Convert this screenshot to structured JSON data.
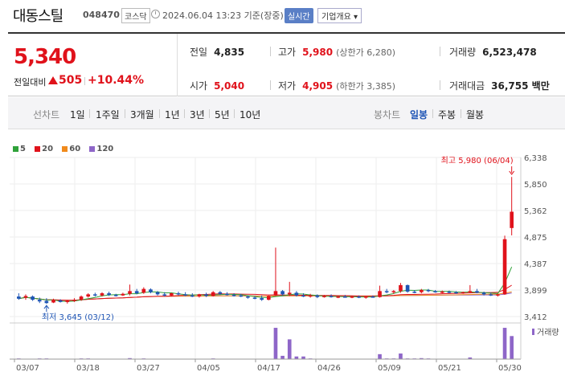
{
  "header": {
    "name": "대동스틸",
    "code": "048470",
    "market": "코스닥",
    "time": "2024.06.04 13:23 기준(장중)",
    "realtime_label": "실시간",
    "overview_label": "기업개요 ▾"
  },
  "quote": {
    "price": "5,340",
    "change_label": "전일대비",
    "change": "505",
    "change_pct": "+10.44%",
    "stats": {
      "prev_close": {
        "label": "전일",
        "value": "4,835"
      },
      "high": {
        "label": "고가",
        "value": "5,980",
        "extra": "(상한가 6,280)"
      },
      "volume": {
        "label": "거래량",
        "value": "6,523,478"
      },
      "open": {
        "label": "시가",
        "value": "5,040"
      },
      "low": {
        "label": "저가",
        "value": "4,905",
        "extra": "(하한가 3,385)"
      },
      "amount": {
        "label": "거래대금",
        "value": "36,755 백만"
      }
    }
  },
  "period_bar": {
    "line_label": "선차트",
    "line_periods": [
      "1일",
      "1주일",
      "3개월",
      "1년",
      "3년",
      "5년",
      "10년"
    ],
    "candle_label": "봉차트",
    "candle_periods": [
      "일봉",
      "주봉",
      "월봉"
    ],
    "selected_candle": "일봉"
  },
  "colors": {
    "up": "#e0121b",
    "down": "#1f55b5",
    "ma5": "#2fa23a",
    "ma20": "#e0121b",
    "ma60": "#f08a1c",
    "ma120": "#8e66c8"
  },
  "chart_data": {
    "type": "candlestick",
    "legend": [
      {
        "name": "5",
        "color": "#2fa23a"
      },
      {
        "name": "20",
        "color": "#e0121b"
      },
      {
        "name": "60",
        "color": "#f08a1c"
      },
      {
        "name": "120",
        "color": "#8e66c8"
      }
    ],
    "y_ticks": [
      "6,338",
      "5,850",
      "5,362",
      "4,875",
      "4,387",
      "3,899",
      "3,412"
    ],
    "ylim": [
      3412,
      6338
    ],
    "x_ticks": [
      "03/07",
      "03/18",
      "03/27",
      "04/05",
      "04/17",
      "04/26",
      "05/09",
      "05/21",
      "05/30"
    ],
    "max_annotation": "최고 5,980 (06/04)",
    "min_annotation": "최저 3,645 (03/12)",
    "volume_label": "거래량",
    "candles": [
      {
        "o": 3780,
        "h": 3840,
        "l": 3720,
        "c": 3740
      },
      {
        "o": 3760,
        "h": 3820,
        "l": 3720,
        "c": 3790
      },
      {
        "o": 3780,
        "h": 3800,
        "l": 3700,
        "c": 3720
      },
      {
        "o": 3720,
        "h": 3760,
        "l": 3660,
        "c": 3690
      },
      {
        "o": 3700,
        "h": 3750,
        "l": 3645,
        "c": 3660
      },
      {
        "o": 3670,
        "h": 3740,
        "l": 3660,
        "c": 3720
      },
      {
        "o": 3710,
        "h": 3730,
        "l": 3670,
        "c": 3680
      },
      {
        "o": 3690,
        "h": 3720,
        "l": 3650,
        "c": 3700
      },
      {
        "o": 3700,
        "h": 3750,
        "l": 3680,
        "c": 3720
      },
      {
        "o": 3720,
        "h": 3800,
        "l": 3700,
        "c": 3780
      },
      {
        "o": 3780,
        "h": 3840,
        "l": 3760,
        "c": 3820
      },
      {
        "o": 3820,
        "h": 3850,
        "l": 3780,
        "c": 3800
      },
      {
        "o": 3800,
        "h": 3860,
        "l": 3780,
        "c": 3840
      },
      {
        "o": 3840,
        "h": 3870,
        "l": 3790,
        "c": 3810
      },
      {
        "o": 3810,
        "h": 3830,
        "l": 3780,
        "c": 3800
      },
      {
        "o": 3800,
        "h": 3850,
        "l": 3790,
        "c": 3830
      },
      {
        "o": 3830,
        "h": 4000,
        "l": 3800,
        "c": 3880
      },
      {
        "o": 3880,
        "h": 3920,
        "l": 3820,
        "c": 3840
      },
      {
        "o": 3850,
        "h": 3950,
        "l": 3830,
        "c": 3920
      },
      {
        "o": 3910,
        "h": 3930,
        "l": 3840,
        "c": 3860
      },
      {
        "o": 3860,
        "h": 3880,
        "l": 3800,
        "c": 3820
      },
      {
        "o": 3820,
        "h": 3860,
        "l": 3780,
        "c": 3800
      },
      {
        "o": 3800,
        "h": 3850,
        "l": 3780,
        "c": 3840
      },
      {
        "o": 3840,
        "h": 3870,
        "l": 3800,
        "c": 3820
      },
      {
        "o": 3820,
        "h": 3860,
        "l": 3790,
        "c": 3800
      },
      {
        "o": 3800,
        "h": 3840,
        "l": 3770,
        "c": 3780
      },
      {
        "o": 3780,
        "h": 3830,
        "l": 3760,
        "c": 3820
      },
      {
        "o": 3820,
        "h": 3850,
        "l": 3770,
        "c": 3790
      },
      {
        "o": 3790,
        "h": 3880,
        "l": 3780,
        "c": 3860
      },
      {
        "o": 3860,
        "h": 3880,
        "l": 3810,
        "c": 3830
      },
      {
        "o": 3830,
        "h": 3860,
        "l": 3800,
        "c": 3810
      },
      {
        "o": 3810,
        "h": 3840,
        "l": 3780,
        "c": 3800
      },
      {
        "o": 3800,
        "h": 3830,
        "l": 3770,
        "c": 3780
      },
      {
        "o": 3780,
        "h": 3800,
        "l": 3740,
        "c": 3760
      },
      {
        "o": 3760,
        "h": 3790,
        "l": 3730,
        "c": 3750
      },
      {
        "o": 3750,
        "h": 3800,
        "l": 3700,
        "c": 3720
      },
      {
        "o": 3720,
        "h": 3800,
        "l": 3710,
        "c": 3790
      },
      {
        "o": 3800,
        "h": 4680,
        "l": 3790,
        "c": 3880
      },
      {
        "o": 3880,
        "h": 3900,
        "l": 3800,
        "c": 3820
      },
      {
        "o": 3820,
        "h": 4050,
        "l": 3790,
        "c": 3850
      },
      {
        "o": 3850,
        "h": 3880,
        "l": 3780,
        "c": 3800
      },
      {
        "o": 3800,
        "h": 3840,
        "l": 3770,
        "c": 3780
      },
      {
        "o": 3790,
        "h": 3830,
        "l": 3760,
        "c": 3800
      },
      {
        "o": 3800,
        "h": 3820,
        "l": 3750,
        "c": 3770
      },
      {
        "o": 3770,
        "h": 3810,
        "l": 3760,
        "c": 3790
      },
      {
        "o": 3790,
        "h": 3820,
        "l": 3760,
        "c": 3770
      },
      {
        "o": 3770,
        "h": 3800,
        "l": 3750,
        "c": 3780
      },
      {
        "o": 3780,
        "h": 3810,
        "l": 3760,
        "c": 3770
      },
      {
        "o": 3770,
        "h": 3790,
        "l": 3750,
        "c": 3780
      },
      {
        "o": 3780,
        "h": 3800,
        "l": 3750,
        "c": 3760
      },
      {
        "o": 3760,
        "h": 3790,
        "l": 3740,
        "c": 3780
      },
      {
        "o": 3780,
        "h": 3800,
        "l": 3760,
        "c": 3770
      },
      {
        "o": 3770,
        "h": 3980,
        "l": 3760,
        "c": 3880
      },
      {
        "o": 3880,
        "h": 3920,
        "l": 3840,
        "c": 3860
      },
      {
        "o": 3860,
        "h": 3900,
        "l": 3830,
        "c": 3880
      },
      {
        "o": 3880,
        "h": 4030,
        "l": 3850,
        "c": 3990
      },
      {
        "o": 3990,
        "h": 4000,
        "l": 3850,
        "c": 3870
      },
      {
        "o": 3870,
        "h": 3900,
        "l": 3840,
        "c": 3860
      },
      {
        "o": 3860,
        "h": 3920,
        "l": 3840,
        "c": 3900
      },
      {
        "o": 3900,
        "h": 3920,
        "l": 3860,
        "c": 3880
      },
      {
        "o": 3880,
        "h": 3900,
        "l": 3850,
        "c": 3860
      },
      {
        "o": 3860,
        "h": 3890,
        "l": 3840,
        "c": 3870
      },
      {
        "o": 3870,
        "h": 3890,
        "l": 3840,
        "c": 3860
      },
      {
        "o": 3860,
        "h": 3880,
        "l": 3830,
        "c": 3850
      },
      {
        "o": 3850,
        "h": 3870,
        "l": 3830,
        "c": 3860
      },
      {
        "o": 3860,
        "h": 3990,
        "l": 3840,
        "c": 3880
      },
      {
        "o": 3880,
        "h": 3920,
        "l": 3840,
        "c": 3850
      },
      {
        "o": 3850,
        "h": 3870,
        "l": 3800,
        "c": 3820
      },
      {
        "o": 3820,
        "h": 3850,
        "l": 3790,
        "c": 3810
      },
      {
        "o": 3810,
        "h": 3830,
        "l": 3780,
        "c": 3820
      },
      {
        "o": 3820,
        "h": 4900,
        "l": 3810,
        "c": 4835
      },
      {
        "o": 5040,
        "h": 5980,
        "l": 4905,
        "c": 5340
      }
    ],
    "volume": [
      0.02,
      0.01,
      0.01,
      0.02,
      0.02,
      0.01,
      0.01,
      0.01,
      0.01,
      0.02,
      0.02,
      0.01,
      0.01,
      0.01,
      0.01,
      0.01,
      0.03,
      0.01,
      0.02,
      0.01,
      0.01,
      0.01,
      0.01,
      0.01,
      0.01,
      0.01,
      0.01,
      0.01,
      0.02,
      0.01,
      0.01,
      0.01,
      0.01,
      0.01,
      0.01,
      0.01,
      0.01,
      0.95,
      0.1,
      0.6,
      0.08,
      0.08,
      0.02,
      0.01,
      0.01,
      0.01,
      0.01,
      0.01,
      0.01,
      0.01,
      0.01,
      0.01,
      0.15,
      0.02,
      0.02,
      0.17,
      0.02,
      0.02,
      0.03,
      0.02,
      0.01,
      0.01,
      0.01,
      0.01,
      0.01,
      0.05,
      0.01,
      0.01,
      0.01,
      0.01,
      0.95,
      0.7
    ]
  }
}
